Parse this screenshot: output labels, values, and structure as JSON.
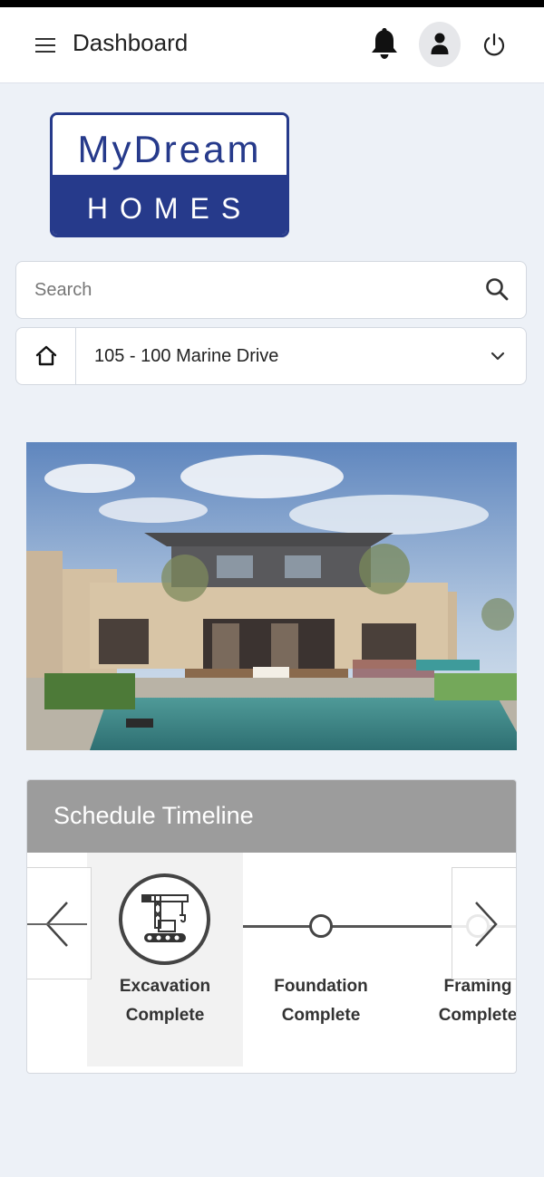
{
  "header": {
    "title": "Dashboard",
    "menu_icon": "hamburger-menu-icon",
    "notification_icon": "bell-icon",
    "profile_icon": "user-icon",
    "logout_icon": "power-icon"
  },
  "logo": {
    "line1": "MyDream",
    "line2": "HOMES",
    "brand_color": "#263a8b"
  },
  "search": {
    "placeholder": "Search",
    "value": "",
    "icon": "search-icon"
  },
  "property_selector": {
    "icon": "home-icon",
    "selected": "105 - 100 Marine Drive",
    "dropdown_icon": "chevron-down-icon"
  },
  "hero_image": {
    "subject": "modern-house-with-pool"
  },
  "schedule": {
    "title": "Schedule Timeline",
    "header_color": "#9c9c9c",
    "steps": [
      {
        "line1": "Excavation",
        "line2": "Complete",
        "icon": "crane-icon",
        "active": true
      },
      {
        "line1": "Foundation",
        "line2": "Complete",
        "icon": "circle-dot-icon",
        "active": false
      },
      {
        "line1": "Framing",
        "line2": "Complete",
        "icon": "circle-dot-icon",
        "active": false
      }
    ],
    "prev_icon": "chevron-left-icon",
    "next_icon": "chevron-right-icon"
  }
}
